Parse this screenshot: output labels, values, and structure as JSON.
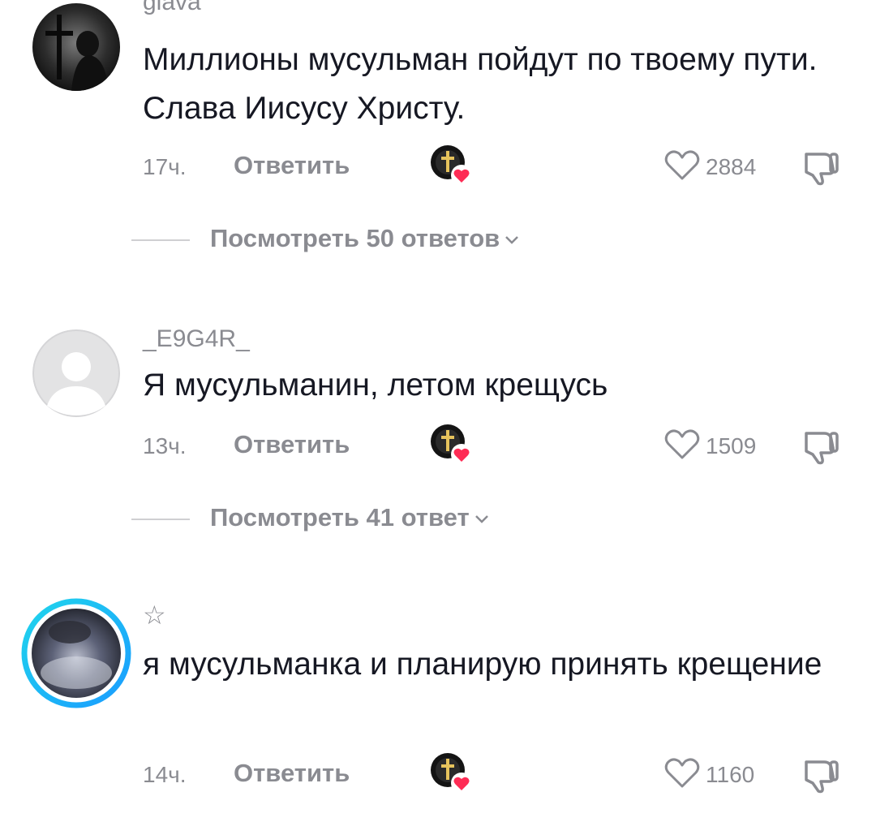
{
  "comments": [
    {
      "username": "glava",
      "text": "Миллионы мусульман пойдут по твоему пути. Слава Иисусу Христу.",
      "time": "17ч.",
      "reply_label": "Ответить",
      "likes": "2884",
      "view_replies": "Посмотреть 50 ответов",
      "avatar_icon": "cross-silhouette-avatar"
    },
    {
      "username": "_E9G4R_",
      "text": "Я мусульманин, летом крещусь",
      "time": "13ч.",
      "reply_label": "Ответить",
      "likes": "1509",
      "view_replies": "Посмотреть 41 ответ",
      "avatar_icon": "default-avatar"
    },
    {
      "username": "☆",
      "text": "я мусульманка и планирую принять крещение",
      "time": "14ч.",
      "reply_label": "Ответить",
      "likes": "1160",
      "avatar_icon": "story-ring-avatar"
    }
  ],
  "icons": {
    "creator_like": "creator-liked-avatar-heart-icon",
    "like": "heart-outline-icon",
    "dislike": "thumb-down-icon",
    "expand": "chevron-down-icon"
  },
  "colors": {
    "text": "#161823",
    "muted": "#8a8b91",
    "heart": "#fe2c55",
    "ring_start": "#20d5ec",
    "ring_end": "#1a9cff"
  }
}
